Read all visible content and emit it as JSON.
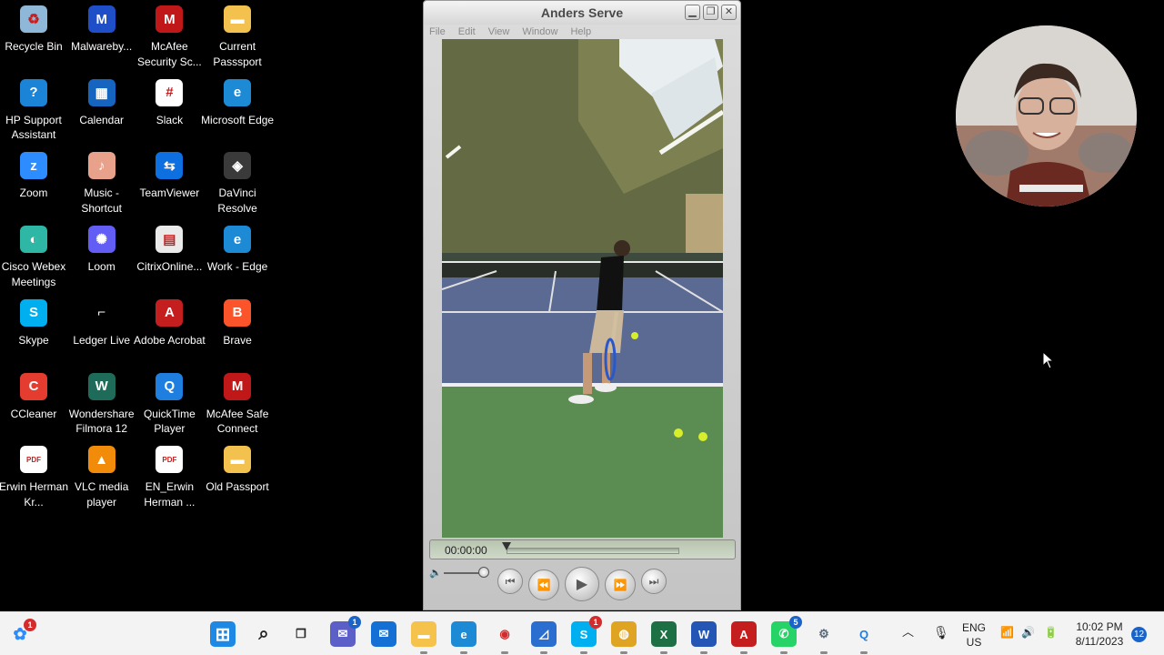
{
  "desktop_icons": [
    {
      "label": "Recycle Bin",
      "icon": "recycle-bin-icon",
      "color": "#8fb8d8"
    },
    {
      "label": "Malwareby...",
      "icon": "malwarebytes-icon",
      "color": "#1f4fc8"
    },
    {
      "label": "McAfee Security Sc...",
      "icon": "mcafee-icon",
      "color": "#c01818"
    },
    {
      "label": "Current Passsport",
      "icon": "folder-icon",
      "color": "#f2c14e"
    },
    {
      "label": "HP Support Assistant",
      "icon": "hp-support-icon",
      "color": "#1b84d6"
    },
    {
      "label": "Calendar",
      "icon": "calendar-icon",
      "color": "#1565c0"
    },
    {
      "label": "Slack",
      "icon": "slack-icon",
      "color": "#ffffff"
    },
    {
      "label": "Microsoft Edge",
      "icon": "edge-icon",
      "color": "#1d8ad6"
    },
    {
      "label": "Zoom",
      "icon": "zoom-icon",
      "color": "#2d8cff"
    },
    {
      "label": "Music - Shortcut",
      "icon": "music-folder-icon",
      "color": "#e8a18a"
    },
    {
      "label": "TeamViewer",
      "icon": "teamviewer-icon",
      "color": "#0e6fe0"
    },
    {
      "label": "DaVinci Resolve",
      "icon": "davinci-resolve-icon",
      "color": "#3a3a3a"
    },
    {
      "label": "Cisco Webex Meetings",
      "icon": "webex-icon",
      "color": "#2fb7a5"
    },
    {
      "label": "Loom",
      "icon": "loom-icon",
      "color": "#625df5"
    },
    {
      "label": "CitrixOnline...",
      "icon": "citrix-icon",
      "color": "#eaeaea"
    },
    {
      "label": "Work - Edge",
      "icon": "edge-work-icon",
      "color": "#1d8ad6"
    },
    {
      "label": "Skype",
      "icon": "skype-icon",
      "color": "#00aff0"
    },
    {
      "label": "Ledger Live",
      "icon": "ledger-live-icon",
      "color": "#000000"
    },
    {
      "label": "Adobe Acrobat",
      "icon": "adobe-acrobat-icon",
      "color": "#c41e1e"
    },
    {
      "label": "Brave",
      "icon": "brave-icon",
      "color": "#fb542b"
    },
    {
      "label": "CCleaner",
      "icon": "ccleaner-icon",
      "color": "#e43d30"
    },
    {
      "label": "Wondershare Filmora 12",
      "icon": "filmora-icon",
      "color": "#1f6b5a"
    },
    {
      "label": "QuickTime Player",
      "icon": "quicktime-icon",
      "color": "#1f7fe0"
    },
    {
      "label": "McAfee Safe Connect",
      "icon": "mcafee-safe-connect-icon",
      "color": "#c01818"
    },
    {
      "label": "Erwin Herman Kr...",
      "icon": "pdf-icon",
      "color": "#ffffff"
    },
    {
      "label": "VLC media player",
      "icon": "vlc-icon",
      "color": "#f28a0a"
    },
    {
      "label": "EN_Erwin Herman ...",
      "icon": "pdf-icon",
      "color": "#ffffff"
    },
    {
      "label": "Old Passport",
      "icon": "folder-icon",
      "color": "#f2c14e"
    }
  ],
  "qt_window": {
    "title": "Anders Serve",
    "menus": [
      "File",
      "Edit",
      "View",
      "Window",
      "Help"
    ],
    "time": "00:00:00",
    "progress": 0.0
  },
  "taskbar": {
    "left_badge": "1",
    "apps": [
      {
        "name": "start",
        "icon": "windows-start-icon"
      },
      {
        "name": "search",
        "icon": "search-icon"
      },
      {
        "name": "task-view",
        "icon": "task-view-icon"
      },
      {
        "name": "chat",
        "icon": "teams-chat-icon",
        "badge": "1"
      },
      {
        "name": "mail",
        "icon": "mail-icon"
      },
      {
        "name": "file-explorer",
        "icon": "folder-icon"
      },
      {
        "name": "edge",
        "icon": "edge-icon"
      },
      {
        "name": "app-red",
        "icon": "red-circle-app-icon"
      },
      {
        "name": "app-chart",
        "icon": "chart-app-icon"
      },
      {
        "name": "skype",
        "icon": "skype-icon",
        "badge": "1"
      },
      {
        "name": "chrome",
        "icon": "chrome-icon"
      },
      {
        "name": "excel",
        "icon": "excel-icon"
      },
      {
        "name": "word",
        "icon": "word-icon"
      },
      {
        "name": "acrobat",
        "icon": "adobe-acrobat-icon"
      },
      {
        "name": "whatsapp",
        "icon": "whatsapp-icon",
        "badge": "5"
      },
      {
        "name": "settings",
        "icon": "gear-icon"
      },
      {
        "name": "quicktime",
        "icon": "quicktime-icon"
      }
    ],
    "lang_top": "ENG",
    "lang_bottom": "US",
    "time": "10:02 PM",
    "date": "8/11/2023",
    "notifications": "12"
  }
}
